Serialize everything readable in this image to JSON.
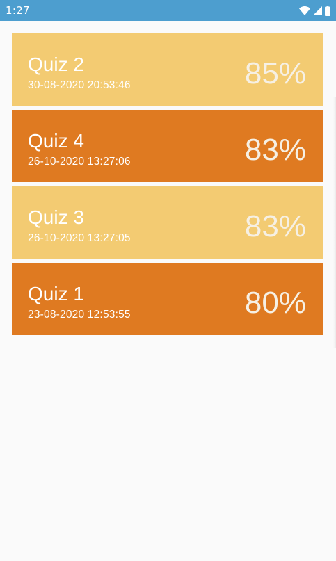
{
  "status_bar": {
    "time": "1:27",
    "background": "#4d9ecf",
    "icons": [
      "wifi-icon",
      "signal-icon",
      "battery-icon"
    ]
  },
  "colors": {
    "light_card": "#f3cb72",
    "dark_card": "#df7a21",
    "score_text": "#f6f0e4",
    "page_background": "#fafafa"
  },
  "results": [
    {
      "title": "Quiz 2",
      "date": "30-08-2020 20:53:46",
      "score": "85%",
      "variant": "light"
    },
    {
      "title": "Quiz 4",
      "date": "26-10-2020 13:27:06",
      "score": "83%",
      "variant": "dark"
    },
    {
      "title": "Quiz 3",
      "date": "26-10-2020 13:27:05",
      "score": "83%",
      "variant": "light"
    },
    {
      "title": "Quiz 1",
      "date": "23-08-2020 12:53:55",
      "score": "80%",
      "variant": "dark"
    }
  ]
}
